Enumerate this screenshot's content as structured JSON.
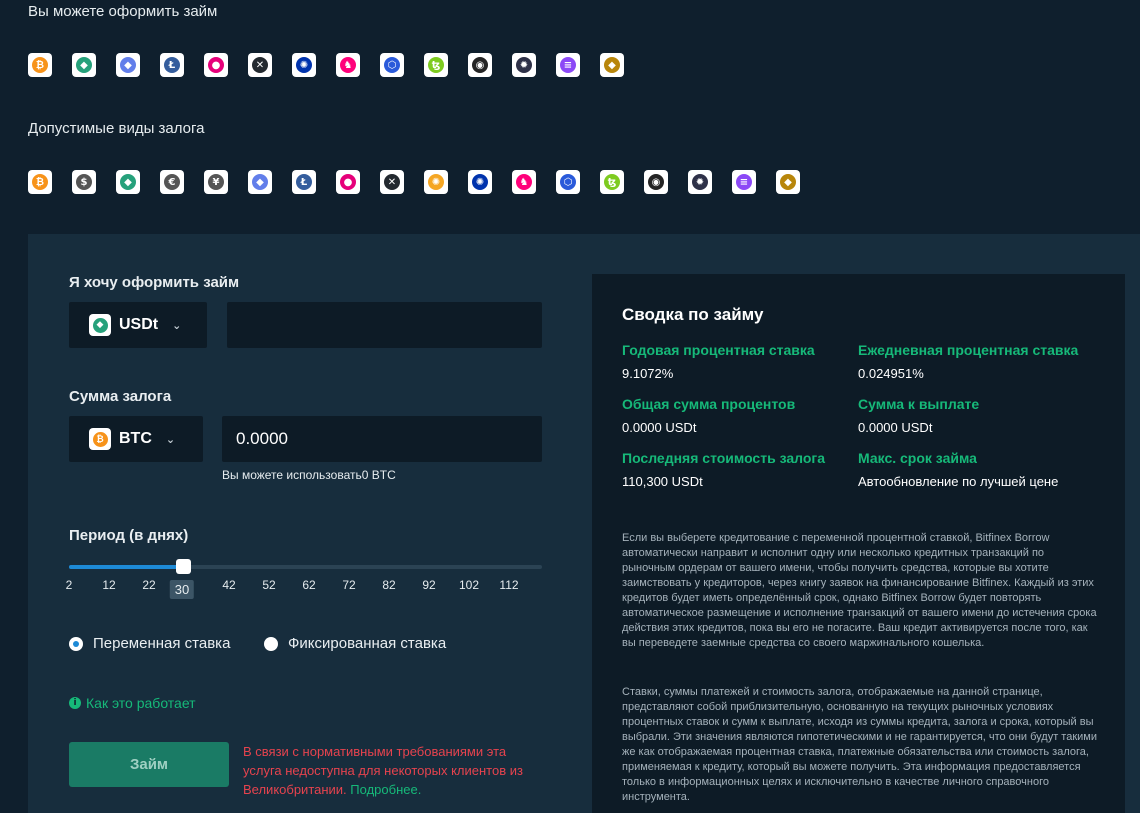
{
  "loanable": {
    "title": "Вы можете оформить займ",
    "coins": [
      {
        "icon": "bitcoin-icon",
        "glyph": "₿",
        "color": "#f7931a"
      },
      {
        "icon": "tether-icon",
        "glyph": "◆",
        "color": "#26a17b"
      },
      {
        "icon": "ethereum-icon",
        "glyph": "◆",
        "color": "#627eea"
      },
      {
        "icon": "litecoin-icon",
        "glyph": "Ł",
        "color": "#345d9d"
      },
      {
        "icon": "polkadot-icon",
        "glyph": "●",
        "color": "#e6007a"
      },
      {
        "icon": "xrp-icon",
        "glyph": "✕",
        "color": "#23292f"
      },
      {
        "icon": "cardano-icon",
        "glyph": "✺",
        "color": "#0033ad"
      },
      {
        "icon": "uniswap-icon",
        "glyph": "♞",
        "color": "#ff007a"
      },
      {
        "icon": "chainlink-icon",
        "glyph": "⬡",
        "color": "#2a5ada"
      },
      {
        "icon": "tezos-icon",
        "glyph": "ꜩ",
        "color": "#7ecb20"
      },
      {
        "icon": "iota-icon",
        "glyph": "◉",
        "color": "#242424"
      },
      {
        "icon": "cosmos-icon",
        "glyph": "✹",
        "color": "#2e3148"
      },
      {
        "icon": "solana-icon",
        "glyph": "≡",
        "color": "#8c49f6"
      },
      {
        "icon": "xaut-icon",
        "glyph": "◆",
        "color": "#b8860b"
      }
    ]
  },
  "collateral": {
    "title": "Допустимые виды залога",
    "coins": [
      {
        "icon": "bitcoin-icon",
        "glyph": "₿",
        "color": "#f7931a"
      },
      {
        "icon": "dollar-icon",
        "glyph": "$",
        "color": "#555555"
      },
      {
        "icon": "tether-icon",
        "glyph": "◆",
        "color": "#26a17b"
      },
      {
        "icon": "euro-icon",
        "glyph": "€",
        "color": "#555555"
      },
      {
        "icon": "yen-icon",
        "glyph": "¥",
        "color": "#555555"
      },
      {
        "icon": "ethereum-icon",
        "glyph": "◆",
        "color": "#627eea"
      },
      {
        "icon": "litecoin-icon",
        "glyph": "Ł",
        "color": "#345d9d"
      },
      {
        "icon": "polkadot-icon",
        "glyph": "●",
        "color": "#e6007a"
      },
      {
        "icon": "xrp-icon",
        "glyph": "✕",
        "color": "#23292f"
      },
      {
        "icon": "yearn-icon",
        "glyph": "✺",
        "color": "#f5a623"
      },
      {
        "icon": "cardano-icon",
        "glyph": "✺",
        "color": "#0033ad"
      },
      {
        "icon": "uniswap-icon",
        "glyph": "♞",
        "color": "#ff007a"
      },
      {
        "icon": "chainlink-icon",
        "glyph": "⬡",
        "color": "#2a5ada"
      },
      {
        "icon": "tezos-icon",
        "glyph": "ꜩ",
        "color": "#7ecb20"
      },
      {
        "icon": "iota-icon",
        "glyph": "◉",
        "color": "#242424"
      },
      {
        "icon": "cosmos-icon",
        "glyph": "✹",
        "color": "#2e3148"
      },
      {
        "icon": "solana-icon",
        "glyph": "≡",
        "color": "#8c49f6"
      },
      {
        "icon": "xaut-icon",
        "glyph": "◆",
        "color": "#b8860b"
      }
    ]
  },
  "form": {
    "loan_label": "Я хочу оформить займ",
    "loan_currency": "USDt",
    "loan_currency_icon": "tether-icon",
    "loan_amount": "",
    "collateral_label": "Сумма залога",
    "collateral_currency": "BTC",
    "collateral_currency_icon": "bitcoin-icon",
    "collateral_amount": "0.0000",
    "available_hint": "Вы можете использовать0 BTC",
    "period_label": "Период (в днях)",
    "period_ticks": [
      "2",
      "12",
      "22",
      "30",
      "42",
      "52",
      "62",
      "72",
      "82",
      "92",
      "102",
      "112"
    ],
    "period_value": "30",
    "slider_fraction": 0.24,
    "rate_variable": "Переменная ставка",
    "rate_fixed": "Фиксированная ставка",
    "how_it_works": "Как это работает",
    "loan_button": "Займ",
    "warning_text": "В связи с нормативными требованиями эта услуга недоступна для некоторых клиентов из Великобритании.",
    "warning_link": "Подробнее."
  },
  "summary": {
    "title": "Сводка по займу",
    "annual_rate_label": "Годовая процентная ставка",
    "annual_rate": "9.1072%",
    "daily_rate_label": "Ежедневная процентная ставка",
    "daily_rate": "0.024951%",
    "total_interest_label": "Общая сумма процентов",
    "total_interest": "0.0000 USDt",
    "payout_label": "Сумма к выплате",
    "payout": "0.0000 USDt",
    "collateral_value_label": "Последняя стоимость залога",
    "collateral_value": "110,300 USDt",
    "max_term_label": "Макс. срок займа",
    "max_term": "Автообновление по лучшей цене",
    "para1": "Если вы выберете кредитование с переменной процентной ставкой, Bitfinex Borrow автоматически направит и исполнит одну или несколько кредитных транзакций по рыночным ордерам от вашего имени, чтобы получить средства, которые вы хотите заимствовать у кредиторов, через книгу заявок на финансирование Bitfinex. Каждый из этих кредитов будет иметь определённый срок, однако Bitfinex Borrow будет повторять автоматическое размещение и исполнение транзакций от вашего имени до истечения срока действия этих кредитов, пока вы его не погасите. Ваш кредит активируется после того, как вы переведете заемные средства со своего маржинального кошелька.",
    "para2": "Ставки, суммы платежей и стоимость залога, отображаемые на данной странице, представляют собой приблизительную, основанную на текущих рыночных условиях процентных ставок и сумм к выплате, исходя из суммы кредита, залога и срока, который вы выбрали. Эти значения являются гипотетическими и не гарантируется, что они будут такими же как отображаемая процентная ставка, платежные обязательства или стоимость залога, применяемая к кредиту, который вы можете получить. Эта информация предоставляется только в информационных целях и исключительно в качестве личного справочного инструмента."
  }
}
